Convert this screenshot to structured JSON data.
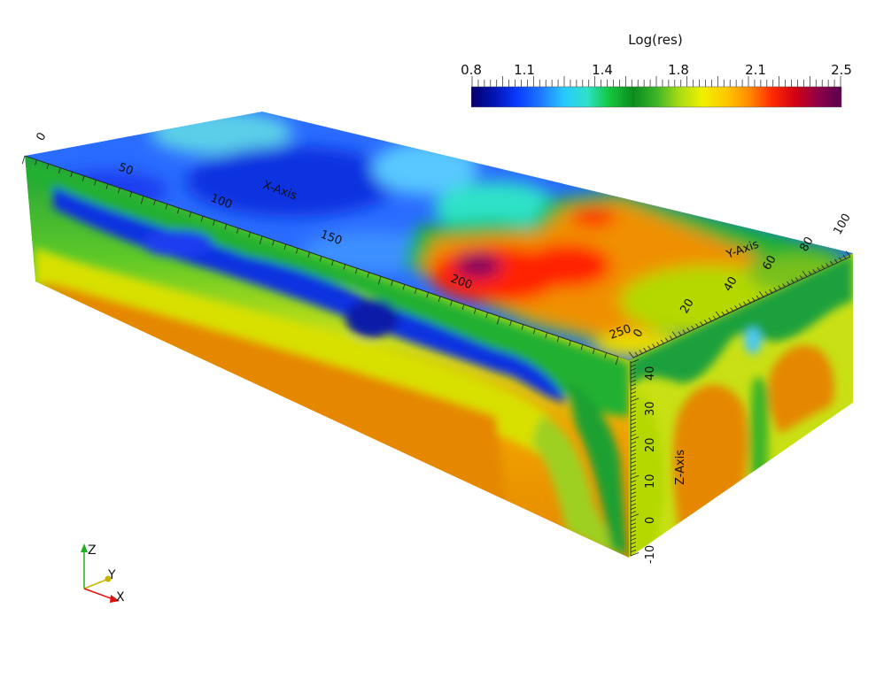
{
  "colorbar": {
    "title": "Log(res)",
    "ticks": [
      "0.8",
      "1.1",
      "1.4",
      "1.8",
      "2.1",
      "2.5"
    ],
    "colors": [
      "#06006a",
      "#0014b4",
      "#0a3cff",
      "#1e78ff",
      "#28c8ff",
      "#2ee2c8",
      "#14c43c",
      "#0a8c1e",
      "#3cb428",
      "#aadc14",
      "#f0f000",
      "#ffc800",
      "#ff8c00",
      "#ff2a00",
      "#d20014",
      "#8c0046",
      "#5a0050"
    ]
  },
  "axes": {
    "x_title": "X-Axis",
    "x_ticks": [
      "0",
      "50",
      "100",
      "150",
      "200",
      "250"
    ],
    "y_title": "Y-Axis",
    "y_ticks": [
      "0",
      "20",
      "40",
      "60",
      "80",
      "100"
    ],
    "z_title": "Z-Axis",
    "z_ticks": [
      "-10",
      "0",
      "10",
      "20",
      "30",
      "40"
    ]
  },
  "orientation": {
    "z": "Z",
    "y": "Y",
    "x": "X",
    "z_color": "#22b022",
    "y_color": "#c8b400",
    "x_color": "#e01010"
  }
}
